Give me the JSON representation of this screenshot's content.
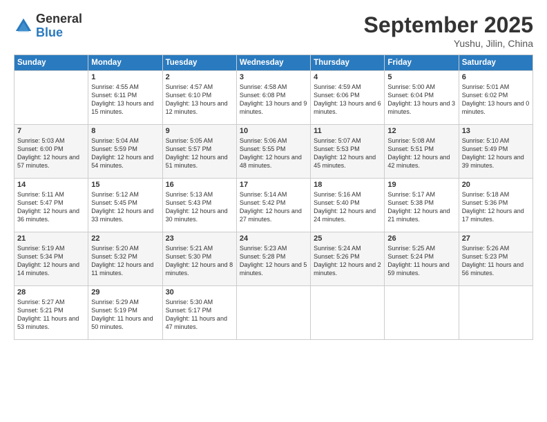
{
  "logo": {
    "general": "General",
    "blue": "Blue"
  },
  "header": {
    "month_year": "September 2025",
    "location": "Yushu, Jilin, China"
  },
  "days_of_week": [
    "Sunday",
    "Monday",
    "Tuesday",
    "Wednesday",
    "Thursday",
    "Friday",
    "Saturday"
  ],
  "weeks": [
    [
      {
        "num": "",
        "info": ""
      },
      {
        "num": "1",
        "info": "Sunrise: 4:55 AM\nSunset: 6:11 PM\nDaylight: 13 hours\nand 15 minutes."
      },
      {
        "num": "2",
        "info": "Sunrise: 4:57 AM\nSunset: 6:10 PM\nDaylight: 13 hours\nand 12 minutes."
      },
      {
        "num": "3",
        "info": "Sunrise: 4:58 AM\nSunset: 6:08 PM\nDaylight: 13 hours\nand 9 minutes."
      },
      {
        "num": "4",
        "info": "Sunrise: 4:59 AM\nSunset: 6:06 PM\nDaylight: 13 hours\nand 6 minutes."
      },
      {
        "num": "5",
        "info": "Sunrise: 5:00 AM\nSunset: 6:04 PM\nDaylight: 13 hours\nand 3 minutes."
      },
      {
        "num": "6",
        "info": "Sunrise: 5:01 AM\nSunset: 6:02 PM\nDaylight: 13 hours\nand 0 minutes."
      }
    ],
    [
      {
        "num": "7",
        "info": "Sunrise: 5:03 AM\nSunset: 6:00 PM\nDaylight: 12 hours\nand 57 minutes."
      },
      {
        "num": "8",
        "info": "Sunrise: 5:04 AM\nSunset: 5:59 PM\nDaylight: 12 hours\nand 54 minutes."
      },
      {
        "num": "9",
        "info": "Sunrise: 5:05 AM\nSunset: 5:57 PM\nDaylight: 12 hours\nand 51 minutes."
      },
      {
        "num": "10",
        "info": "Sunrise: 5:06 AM\nSunset: 5:55 PM\nDaylight: 12 hours\nand 48 minutes."
      },
      {
        "num": "11",
        "info": "Sunrise: 5:07 AM\nSunset: 5:53 PM\nDaylight: 12 hours\nand 45 minutes."
      },
      {
        "num": "12",
        "info": "Sunrise: 5:08 AM\nSunset: 5:51 PM\nDaylight: 12 hours\nand 42 minutes."
      },
      {
        "num": "13",
        "info": "Sunrise: 5:10 AM\nSunset: 5:49 PM\nDaylight: 12 hours\nand 39 minutes."
      }
    ],
    [
      {
        "num": "14",
        "info": "Sunrise: 5:11 AM\nSunset: 5:47 PM\nDaylight: 12 hours\nand 36 minutes."
      },
      {
        "num": "15",
        "info": "Sunrise: 5:12 AM\nSunset: 5:45 PM\nDaylight: 12 hours\nand 33 minutes."
      },
      {
        "num": "16",
        "info": "Sunrise: 5:13 AM\nSunset: 5:43 PM\nDaylight: 12 hours\nand 30 minutes."
      },
      {
        "num": "17",
        "info": "Sunrise: 5:14 AM\nSunset: 5:42 PM\nDaylight: 12 hours\nand 27 minutes."
      },
      {
        "num": "18",
        "info": "Sunrise: 5:16 AM\nSunset: 5:40 PM\nDaylight: 12 hours\nand 24 minutes."
      },
      {
        "num": "19",
        "info": "Sunrise: 5:17 AM\nSunset: 5:38 PM\nDaylight: 12 hours\nand 21 minutes."
      },
      {
        "num": "20",
        "info": "Sunrise: 5:18 AM\nSunset: 5:36 PM\nDaylight: 12 hours\nand 17 minutes."
      }
    ],
    [
      {
        "num": "21",
        "info": "Sunrise: 5:19 AM\nSunset: 5:34 PM\nDaylight: 12 hours\nand 14 minutes."
      },
      {
        "num": "22",
        "info": "Sunrise: 5:20 AM\nSunset: 5:32 PM\nDaylight: 12 hours\nand 11 minutes."
      },
      {
        "num": "23",
        "info": "Sunrise: 5:21 AM\nSunset: 5:30 PM\nDaylight: 12 hours\nand 8 minutes."
      },
      {
        "num": "24",
        "info": "Sunrise: 5:23 AM\nSunset: 5:28 PM\nDaylight: 12 hours\nand 5 minutes."
      },
      {
        "num": "25",
        "info": "Sunrise: 5:24 AM\nSunset: 5:26 PM\nDaylight: 12 hours\nand 2 minutes."
      },
      {
        "num": "26",
        "info": "Sunrise: 5:25 AM\nSunset: 5:24 PM\nDaylight: 11 hours\nand 59 minutes."
      },
      {
        "num": "27",
        "info": "Sunrise: 5:26 AM\nSunset: 5:23 PM\nDaylight: 11 hours\nand 56 minutes."
      }
    ],
    [
      {
        "num": "28",
        "info": "Sunrise: 5:27 AM\nSunset: 5:21 PM\nDaylight: 11 hours\nand 53 minutes."
      },
      {
        "num": "29",
        "info": "Sunrise: 5:29 AM\nSunset: 5:19 PM\nDaylight: 11 hours\nand 50 minutes."
      },
      {
        "num": "30",
        "info": "Sunrise: 5:30 AM\nSunset: 5:17 PM\nDaylight: 11 hours\nand 47 minutes."
      },
      {
        "num": "",
        "info": ""
      },
      {
        "num": "",
        "info": ""
      },
      {
        "num": "",
        "info": ""
      },
      {
        "num": "",
        "info": ""
      }
    ]
  ]
}
